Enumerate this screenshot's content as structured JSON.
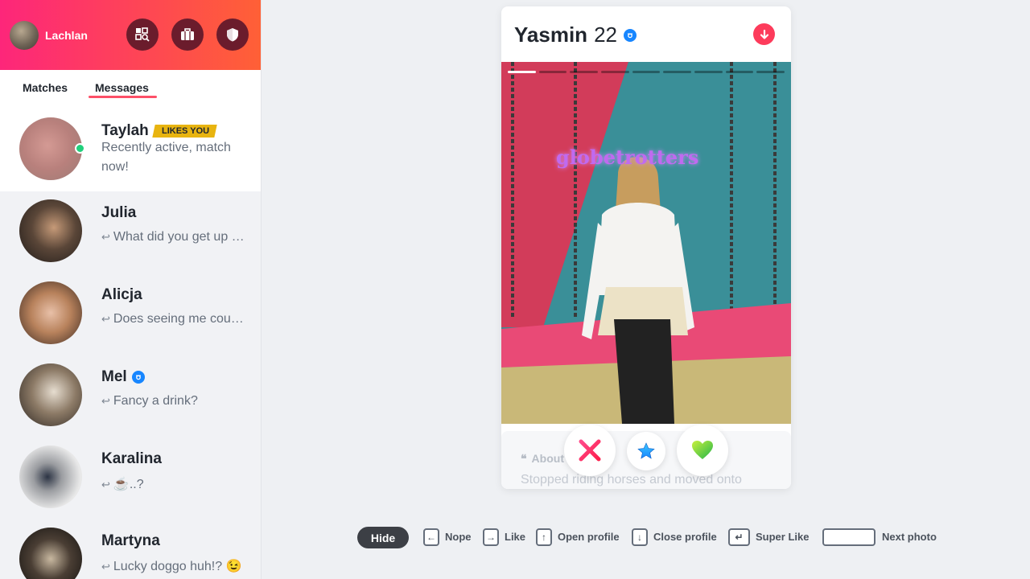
{
  "user": {
    "name": "Lachlan"
  },
  "header_buttons": [
    {
      "name": "explore",
      "icon": "grid-search-icon"
    },
    {
      "name": "work",
      "icon": "briefcase-icon"
    },
    {
      "name": "safety",
      "icon": "shield-icon"
    }
  ],
  "tabs": {
    "matches": "Matches",
    "messages": "Messages",
    "active": "Messages"
  },
  "conversations": [
    {
      "name": "Taylah",
      "badge": "LIKES YOU",
      "message": "Recently active, match now!",
      "online": true,
      "active": true
    },
    {
      "name": "Julia",
      "message": "What did you get up …",
      "reply": true
    },
    {
      "name": "Alicja",
      "message": "Does seeing me cou…",
      "reply": true
    },
    {
      "name": "Mel",
      "verified": true,
      "message": "Fancy a drink?",
      "reply": true
    },
    {
      "name": "Karalina",
      "message": "☕..?",
      "reply": true
    },
    {
      "name": "Martyna",
      "message": "Lucky doggo huh!? 😉",
      "reply": true
    }
  ],
  "profile": {
    "name": "Yasmin",
    "age": "22",
    "verified": true,
    "photo_count": 9,
    "current_photo": 1,
    "photo_sign_text": "globetrotters",
    "about_title": "About",
    "about_text": "Stopped riding horses and moved onto"
  },
  "actions": {
    "nope": "nope-icon",
    "super_like": "star-icon",
    "like": "heart-icon"
  },
  "shortcuts": {
    "hide": "Hide",
    "nope": "Nope",
    "like": "Like",
    "open_profile": "Open profile",
    "close_profile": "Close profile",
    "super_like": "Super Like",
    "next_photo": "Next photo"
  },
  "colors": {
    "brand_start": "#fd267a",
    "brand_end": "#ff6036",
    "badge": "#e8b410",
    "online": "#21d07c",
    "verify": "#1786ff"
  }
}
